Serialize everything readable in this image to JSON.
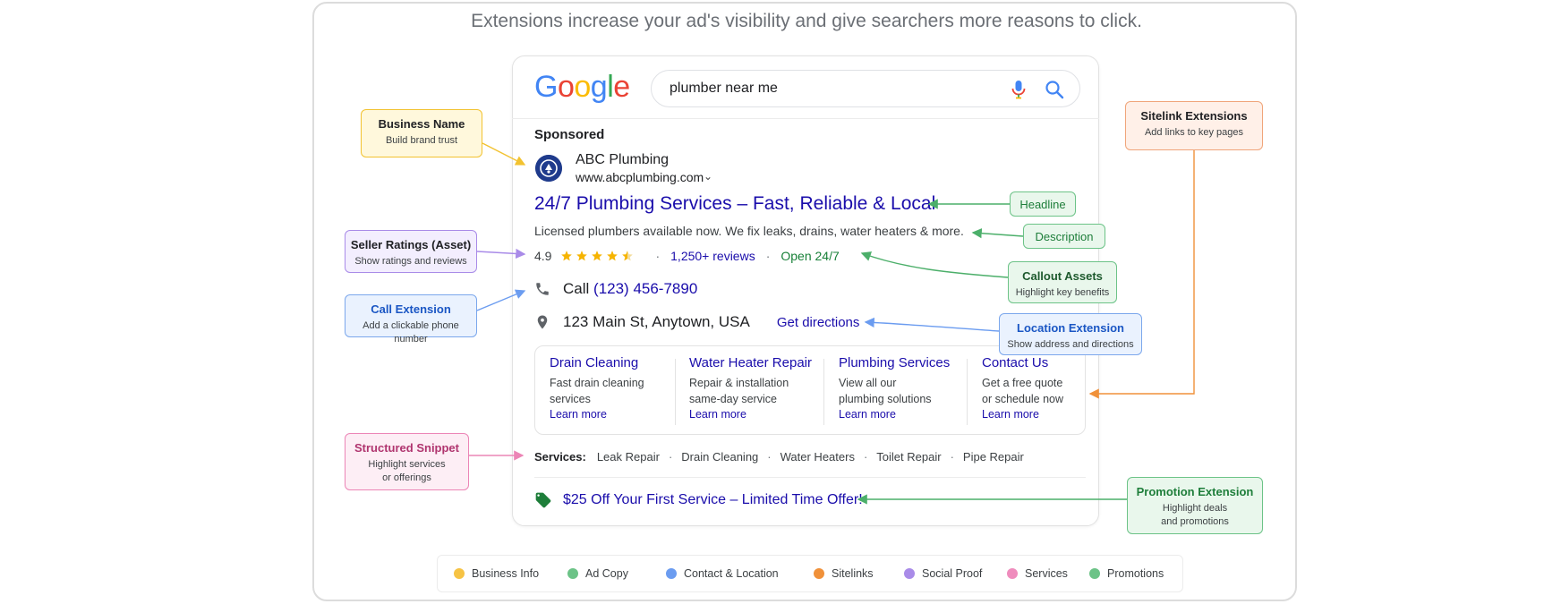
{
  "intro": "Extensions increase your ad's visibility and give searchers more reasons to click.",
  "search": {
    "logo_letters": [
      {
        "ch": "G",
        "color": "#4285F4"
      },
      {
        "ch": "o",
        "color": "#EA4335"
      },
      {
        "ch": "o",
        "color": "#FBBC05"
      },
      {
        "ch": "g",
        "color": "#4285F4"
      },
      {
        "ch": "l",
        "color": "#34A853"
      },
      {
        "ch": "e",
        "color": "#EA4335"
      }
    ],
    "query": "plumber near me"
  },
  "ad": {
    "sponsored": "Sponsored",
    "business_name": "ABC Plumbing",
    "url": "www.abcplumbing.com",
    "title": "24/7 Plumbing Services – Fast, Reliable & Local",
    "description": "Licensed plumbers available now. We fix leaks, drains, water heaters & more.",
    "rating": "4.9",
    "rating_stars": 4.5,
    "reviews": "1,250+ reviews",
    "open": "Open 24/7",
    "call_label": "Call",
    "phone": "(123) 456-7890",
    "address": "123 Main St, Anytown, USA",
    "directions": "Get directions",
    "sitelinks": [
      {
        "title": "Drain Cleaning",
        "desc": "Fast drain cleaning\nservices",
        "more": "Learn more"
      },
      {
        "title": "Water Heater Repair",
        "desc": "Repair & installation\nsame-day service",
        "more": "Learn more"
      },
      {
        "title": "Plumbing Services",
        "desc": "View all our\nplumbing solutions",
        "more": "Learn more"
      },
      {
        "title": "Contact Us",
        "desc": "Get a free quote\nor schedule now",
        "more": "Learn more"
      }
    ],
    "services_label": "Services:",
    "services": [
      "Leak Repair",
      "Drain Cleaning",
      "Water Heaters",
      "Toilet Repair",
      "Pipe Repair"
    ],
    "promotion": "$25 Off Your First Service – Limited Time Offer!"
  },
  "callouts": {
    "business_name": {
      "title": "Business Name",
      "sub": "Build brand trust",
      "color": "#f2c230"
    },
    "seller_ratings": {
      "title": "Seller Ratings (Asset)",
      "sub": "Show ratings and reviews",
      "color": "#a98be8"
    },
    "call_extension": {
      "title": "Call Extension",
      "sub": "Add a clickable phone number",
      "color": "#7ba7ec"
    },
    "structured_snippet": {
      "title": "Structured Snippet",
      "sub": "Highlight services\nor offerings",
      "color": "#ec85b6"
    },
    "sitelink_extensions": {
      "title": "Sitelink Extensions",
      "sub": "Add links to key pages",
      "color": "#f0a57a"
    },
    "headline": {
      "title": "Headline",
      "sub": "",
      "color": "#6cc387"
    },
    "description": {
      "title": "Description",
      "sub": "",
      "color": "#6cc387"
    },
    "callout_assets": {
      "title": "Callout Assets",
      "sub": "Highlight key benefits",
      "color": "#6cc387"
    },
    "location_extension": {
      "title": "Location Extension",
      "sub": "Show address and directions",
      "color": "#7ba7ec"
    },
    "promotion_extension": {
      "title": "Promotion Extension",
      "sub": "Highlight deals\nand promotions",
      "color": "#6cc387"
    }
  },
  "legend": [
    {
      "label": "Business Info",
      "color": "#f6c344"
    },
    {
      "label": "Ad Copy",
      "color": "#6cc387"
    },
    {
      "label": "Contact & Location",
      "color": "#6b9cf0"
    },
    {
      "label": "Sitelinks",
      "color": "#f0913a"
    },
    {
      "label": "Social Proof",
      "color": "#a98be8"
    },
    {
      "label": "Services",
      "color": "#ef8cbd"
    },
    {
      "label": "Promotions",
      "color": "#6cc387"
    }
  ]
}
